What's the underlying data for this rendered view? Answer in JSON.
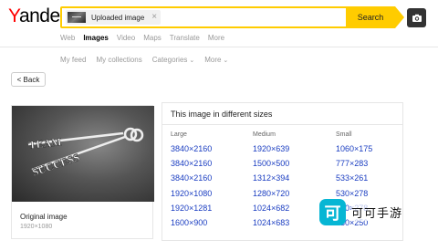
{
  "header": {
    "logo_y": "Y",
    "logo_rest": "andex",
    "search_chip_label": "Uploaded image",
    "search_clear_glyph": "×",
    "search_button": "Search",
    "camera_icon": "camera-icon"
  },
  "tabs": [
    {
      "label": "Web",
      "active": false
    },
    {
      "label": "Images",
      "active": true
    },
    {
      "label": "Video",
      "active": false
    },
    {
      "label": "Maps",
      "active": false
    },
    {
      "label": "Translate",
      "active": false
    },
    {
      "label": "More",
      "active": false
    }
  ],
  "filters": {
    "my_feed": "My feed",
    "my_collections": "My collections",
    "categories": "Categories",
    "more": "More"
  },
  "back_button": "< Back",
  "original": {
    "image_word_1": "TEAM",
    "image_word_2": "SUCCESS",
    "title": "Original image",
    "dimensions": "1920×1080"
  },
  "sizes": {
    "title": "This image in different sizes",
    "columns": [
      {
        "heading": "Large",
        "items": [
          "3840×2160",
          "3840×2160",
          "3840×2160",
          "1920×1080",
          "1920×1281",
          "1600×900"
        ]
      },
      {
        "heading": "Medium",
        "items": [
          "1920×639",
          "1500×500",
          "1312×394",
          "1280×720",
          "1024×682",
          "1024×683"
        ]
      },
      {
        "heading": "Small",
        "items": [
          "1060×175",
          "777×283",
          "533×261",
          "530×278",
          "530×278",
          "530×250"
        ]
      }
    ]
  },
  "watermark": {
    "icon_glyph": "可",
    "text": "可可手游"
  },
  "colors": {
    "accent": "#ffcc00",
    "link": "#1a3dc1",
    "logo_red": "#ff0000"
  }
}
